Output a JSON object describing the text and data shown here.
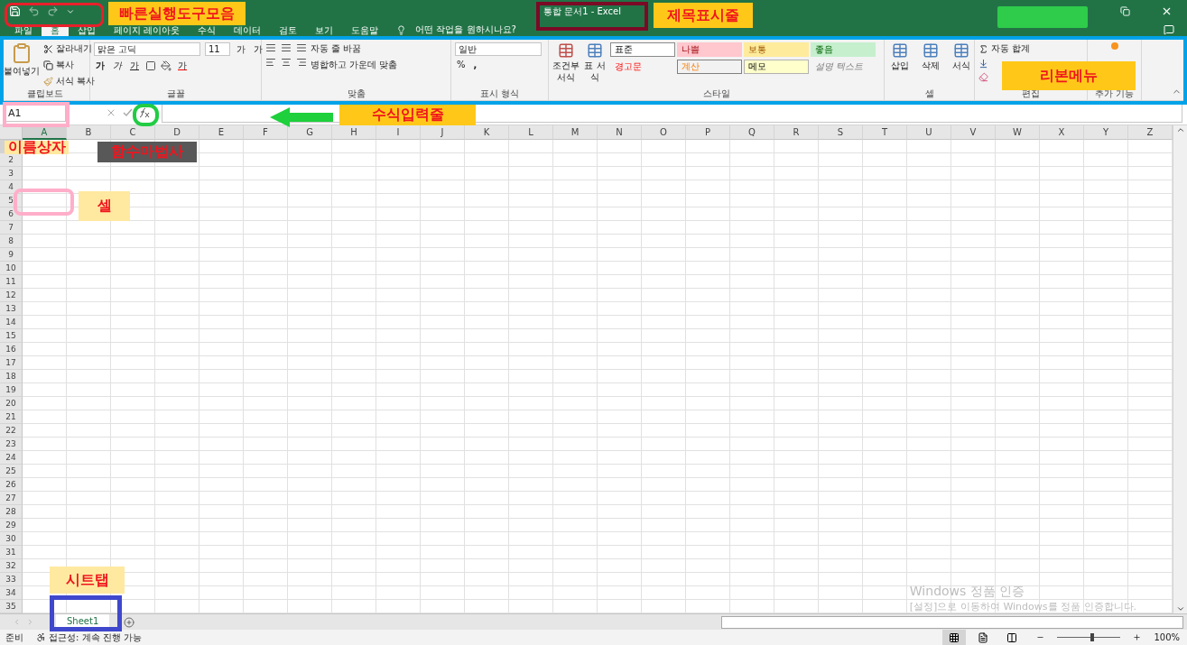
{
  "title_bar": {
    "title": "통합 문서1  -  Excel"
  },
  "menu_tabs": [
    {
      "label": "파일",
      "selected": false
    },
    {
      "label": "홈",
      "selected": true
    },
    {
      "label": "삽입",
      "selected": false
    },
    {
      "label": "페이지 레이아웃",
      "selected": false
    },
    {
      "label": "수식",
      "selected": false
    },
    {
      "label": "데이터",
      "selected": false
    },
    {
      "label": "검토",
      "selected": false
    },
    {
      "label": "보기",
      "selected": false
    },
    {
      "label": "도움말",
      "selected": false
    }
  ],
  "tell_me": "어떤 작업을 원하시나요?",
  "ribbon": {
    "clipboard": {
      "paste": "붙여넣기",
      "cut": "잘라내기",
      "copy": "복사",
      "format_painter": "서식 복사",
      "label": "클립보드"
    },
    "font": {
      "name": "맑은 고딕",
      "size": "11",
      "grow": "가",
      "shrink": "가",
      "bold": "가",
      "italic": "가",
      "underline": "가",
      "font_color": "가",
      "label": "글꼴"
    },
    "alignment": {
      "wrap_text": "자동 줄 바꿈",
      "merge": "병합하고 가운데 맞춤",
      "label": "맞춤"
    },
    "number": {
      "format": "일반",
      "percent": "%",
      "comma": ",",
      "label": "표시 형식"
    },
    "styles": {
      "conditional_formatting": "조건부 서식",
      "format_as_table": "표 서식",
      "label": "스타일",
      "items": [
        {
          "label": "표준",
          "kind": "normal"
        },
        {
          "label": "나쁨",
          "kind": "bad"
        },
        {
          "label": "보통",
          "kind": "neutral"
        },
        {
          "label": "좋음",
          "kind": "good"
        },
        {
          "label": "경고문",
          "kind": "warning"
        },
        {
          "label": "계산",
          "kind": "calculation"
        },
        {
          "label": "메모",
          "kind": "note"
        },
        {
          "label": "설명 텍스트",
          "kind": "explanatory"
        }
      ]
    },
    "cells": {
      "buttons": [
        "삽입",
        "삭제",
        "서식"
      ],
      "label": "셀"
    },
    "editing": {
      "autosum": "자동 합계",
      "label": "편집"
    },
    "addins": {
      "label": "추가 기능"
    }
  },
  "formula_bar": {
    "name_box": "A1"
  },
  "columns": [
    {
      "label": "A",
      "selected": true
    },
    {
      "label": "B",
      "selected": false
    },
    {
      "label": "C",
      "selected": false
    },
    {
      "label": "D",
      "selected": false
    },
    {
      "label": "E",
      "selected": false
    },
    {
      "label": "F",
      "selected": false
    },
    {
      "label": "G",
      "selected": false
    },
    {
      "label": "H",
      "selected": false
    },
    {
      "label": "I",
      "selected": false
    },
    {
      "label": "J",
      "selected": false
    },
    {
      "label": "K",
      "selected": false
    },
    {
      "label": "L",
      "selected": false
    },
    {
      "label": "M",
      "selected": false
    },
    {
      "label": "N",
      "selected": false
    },
    {
      "label": "O",
      "selected": false
    },
    {
      "label": "P",
      "selected": false
    },
    {
      "label": "Q",
      "selected": false
    },
    {
      "label": "R",
      "selected": false
    },
    {
      "label": "S",
      "selected": false
    },
    {
      "label": "T",
      "selected": false
    },
    {
      "label": "U",
      "selected": false
    },
    {
      "label": "V",
      "selected": false
    },
    {
      "label": "W",
      "selected": false
    },
    {
      "label": "X",
      "selected": false
    },
    {
      "label": "Y",
      "selected": false
    },
    {
      "label": "Z",
      "selected": false
    }
  ],
  "rows": [
    "2",
    "3",
    "4",
    "5",
    "6",
    "7",
    "8",
    "9",
    "10",
    "11",
    "12",
    "13",
    "14",
    "15",
    "16",
    "17",
    "18",
    "19",
    "20",
    "21",
    "22",
    "23",
    "24",
    "25",
    "26",
    "27",
    "28",
    "29",
    "30",
    "31",
    "32",
    "33",
    "34",
    "35"
  ],
  "sheet_tabs": [
    {
      "label": "Sheet1",
      "selected": true
    }
  ],
  "status_bar": {
    "mode": "준비",
    "accessibility": "접근성: 계속 진행 가능",
    "views": [
      {
        "kind": "normal",
        "selected": true
      },
      {
        "kind": "page_layout",
        "selected": false
      },
      {
        "kind": "page_break",
        "selected": false
      }
    ],
    "zoom_slider": {
      "level": 0.55
    },
    "zoom": "100%"
  },
  "activation_notice": {
    "title": "Windows 정품 인증",
    "text": "[설정]으로 이동하여 Windows를 정품 인증합니다."
  },
  "annotations": [
    {
      "text": "빠른실행도구모음",
      "kind": "callout"
    },
    {
      "text": "제목표시줄",
      "kind": "callout"
    },
    {
      "text": "리본메뉴",
      "kind": "callout"
    },
    {
      "text": "수식입력줄",
      "kind": "callout"
    },
    {
      "text": "이름상자",
      "kind": "note"
    },
    {
      "text": "함수마법사",
      "kind": "dark"
    },
    {
      "text": "셀",
      "kind": "note"
    },
    {
      "text": "시트탭",
      "kind": "note"
    }
  ]
}
